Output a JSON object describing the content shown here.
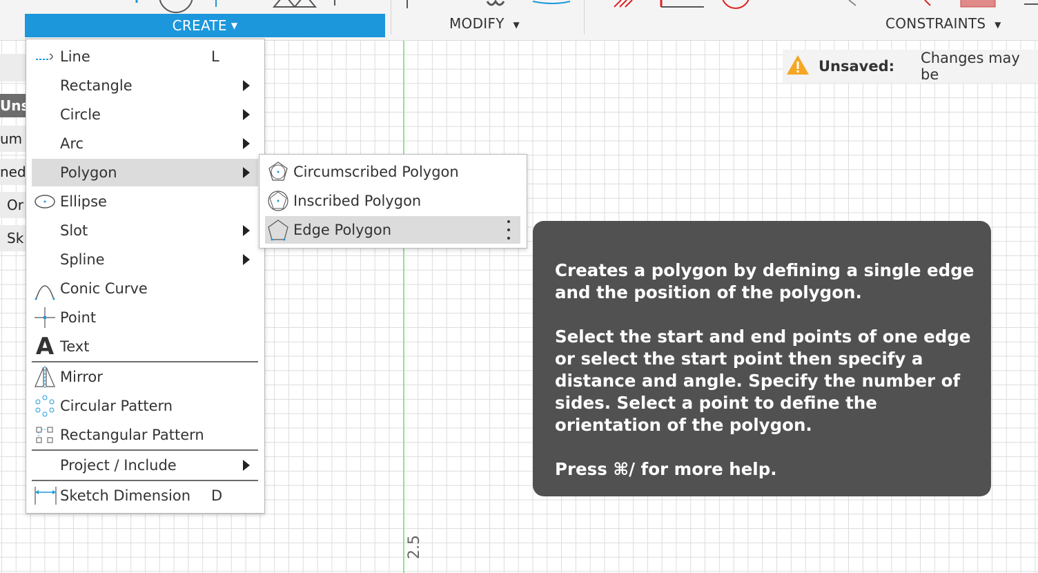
{
  "toolbar": {
    "create_label": "CREATE",
    "modify_label": "MODIFY",
    "constraints_label": "CONSTRAINTS",
    "accent_color": "#1d97dc"
  },
  "left_panel": {
    "items": [
      "Uns",
      "um",
      "ned",
      "Or",
      "Sk"
    ]
  },
  "status": {
    "title": "Unsaved:",
    "message": "Changes may be"
  },
  "create_menu": {
    "items": [
      {
        "label": "Line",
        "shortcut": "L",
        "icon": "line-icon"
      },
      {
        "label": "Rectangle",
        "icon": "none",
        "submenu": true
      },
      {
        "label": "Circle",
        "icon": "none",
        "submenu": true
      },
      {
        "label": "Arc",
        "icon": "none",
        "submenu": true
      },
      {
        "label": "Polygon",
        "icon": "none",
        "submenu": true,
        "highlighted": true
      },
      {
        "label": "Ellipse",
        "icon": "ellipse-icon"
      },
      {
        "label": "Slot",
        "icon": "none",
        "submenu": true
      },
      {
        "label": "Spline",
        "icon": "none",
        "submenu": true
      },
      {
        "label": "Conic Curve",
        "icon": "conic-curve-icon"
      },
      {
        "label": "Point",
        "icon": "point-icon"
      },
      {
        "label": "Text",
        "icon": "text-icon"
      },
      {
        "label": "Mirror",
        "icon": "mirror-icon"
      },
      {
        "label": "Circular Pattern",
        "icon": "circular-pattern-icon"
      },
      {
        "label": "Rectangular Pattern",
        "icon": "rectangular-pattern-icon"
      },
      {
        "label": "Project / Include",
        "icon": "none",
        "submenu": true
      },
      {
        "label": "Sketch Dimension",
        "shortcut": "D",
        "icon": "sketch-dimension-icon"
      }
    ]
  },
  "polygon_submenu": {
    "items": [
      {
        "label": "Circumscribed Polygon",
        "icon": "circumscribed-polygon-icon"
      },
      {
        "label": "Inscribed Polygon",
        "icon": "inscribed-polygon-icon"
      },
      {
        "label": "Edge Polygon",
        "icon": "edge-polygon-icon",
        "highlighted": true
      }
    ]
  },
  "tooltip": {
    "para1": "Creates a polygon by defining a single edge and the position of the polygon.",
    "para2": "Select the start and end points of one edge or select the start point then specify a distance and angle. Specify the number of sides. Select a point to define the orientation of the polygon.",
    "para3": "Press ⌘/ for more help."
  },
  "canvas": {
    "axis_value": "2.5"
  }
}
